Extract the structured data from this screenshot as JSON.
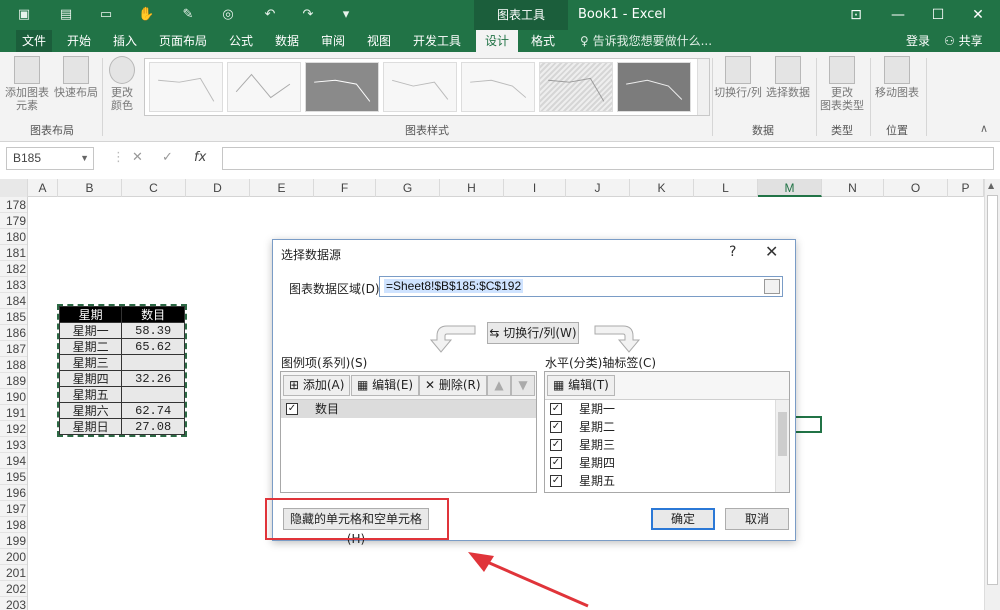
{
  "titlebar": {
    "context_tab": "图表工具",
    "book_title": "Book1 - Excel"
  },
  "tabs": [
    "文件",
    "开始",
    "插入",
    "页面布局",
    "公式",
    "数据",
    "审阅",
    "视图",
    "开发工具",
    "设计",
    "格式"
  ],
  "tell_me": "告诉我您想要做什么...",
  "account": {
    "login": "登录",
    "share": "共享"
  },
  "ribbon": {
    "add_element": "添加图表\n元素",
    "quick_layout": "快速布局",
    "change_color": "更改\n颜色",
    "group_layouts": "图表布局",
    "group_styles": "图表样式",
    "switch_row_col": "切换行/列",
    "select_data": "选择数据",
    "group_data": "数据",
    "change_type": "更改\n图表类型",
    "group_type": "类型",
    "move_chart": "移动图表",
    "group_location": "位置"
  },
  "formula_bar": {
    "name_box": "B185",
    "fx": "fx",
    "formula": ""
  },
  "columns": [
    "A",
    "B",
    "C",
    "D",
    "E",
    "F",
    "G",
    "H",
    "I",
    "J",
    "K",
    "L",
    "M",
    "N",
    "O",
    "P"
  ],
  "rows": [
    "178",
    "179",
    "180",
    "181",
    "182",
    "183",
    "184",
    "185",
    "186",
    "187",
    "188",
    "189",
    "190",
    "191",
    "192",
    "193",
    "194",
    "195",
    "196",
    "197",
    "198",
    "199",
    "200",
    "201",
    "202",
    "203"
  ],
  "table": {
    "headers": [
      "星期",
      "数目"
    ],
    "rows": [
      [
        "星期一",
        "58.39"
      ],
      [
        "星期二",
        "65.62"
      ],
      [
        "星期三",
        ""
      ],
      [
        "星期四",
        "32.26"
      ],
      [
        "星期五",
        ""
      ],
      [
        "星期六",
        "62.74"
      ],
      [
        "星期日",
        "27.08"
      ]
    ]
  },
  "dialog": {
    "title": "选择数据源",
    "help": "?",
    "close": "✕",
    "range_label": "图表数据区域(D):",
    "range_value": "=Sheet8!$B$185:$C$192",
    "switch_label": "切换行/列(W)",
    "legend_label": "图例项(系列)(S)",
    "axis_label": "水平(分类)轴标签(C)",
    "legend_buttons": {
      "add": "添加(A)",
      "edit": "编辑(E)",
      "delete": "删除(R)",
      "up": "▲",
      "down": "▼"
    },
    "axis_buttons": {
      "edit": "编辑(T)"
    },
    "series": [
      "数目"
    ],
    "categories": [
      "星期一",
      "星期二",
      "星期三",
      "星期四",
      "星期五"
    ],
    "hidden_cells": "隐藏的单元格和空单元格(H)",
    "ok": "确定",
    "cancel": "取消"
  }
}
